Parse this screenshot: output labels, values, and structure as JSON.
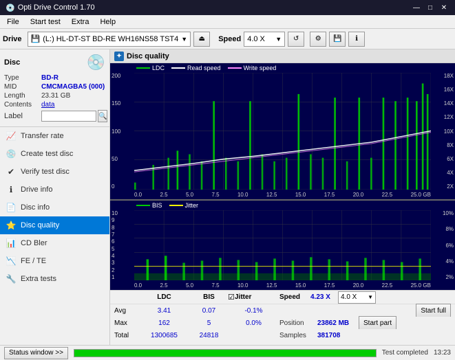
{
  "titlebar": {
    "title": "Opti Drive Control 1.70",
    "icon": "💿",
    "controls": [
      "—",
      "□",
      "✕"
    ]
  },
  "menubar": {
    "items": [
      "File",
      "Start test",
      "Extra",
      "Help"
    ]
  },
  "toolbar": {
    "drive_label": "Drive",
    "drive_icon": "💾",
    "drive_text": "(L:)  HL-DT-ST BD-RE  WH16NS58 TST4",
    "speed_label": "Speed",
    "speed_value": "4.0 X"
  },
  "disc": {
    "title": "Disc",
    "type_label": "Type",
    "type_value": "BD-R",
    "mid_label": "MID",
    "mid_value": "CMCMAGBA5 (000)",
    "length_label": "Length",
    "length_value": "23.31 GB",
    "contents_label": "Contents",
    "contents_value": "data",
    "label_label": "Label",
    "label_value": ""
  },
  "nav": {
    "items": [
      {
        "id": "transfer-rate",
        "label": "Transfer rate",
        "icon": "📈"
      },
      {
        "id": "create-test-disc",
        "label": "Create test disc",
        "icon": "💿"
      },
      {
        "id": "verify-test-disc",
        "label": "Verify test disc",
        "icon": "✔"
      },
      {
        "id": "drive-info",
        "label": "Drive info",
        "icon": "ℹ"
      },
      {
        "id": "disc-info",
        "label": "Disc info",
        "icon": "📄"
      },
      {
        "id": "disc-quality",
        "label": "Disc quality",
        "icon": "⭐",
        "active": true
      },
      {
        "id": "cd-bler",
        "label": "CD Bler",
        "icon": "📊"
      },
      {
        "id": "fe-te",
        "label": "FE / TE",
        "icon": "📉"
      },
      {
        "id": "extra-tests",
        "label": "Extra tests",
        "icon": "🔧"
      }
    ]
  },
  "chart": {
    "title": "Disc quality",
    "top": {
      "legend": [
        {
          "label": "LDC",
          "color": "#00aa00"
        },
        {
          "label": "Read speed",
          "color": "#ffffff"
        },
        {
          "label": "Write speed",
          "color": "#ff00ff"
        }
      ],
      "y_left": [
        "200",
        "150",
        "100",
        "50",
        "0"
      ],
      "y_right": [
        "18X",
        "16X",
        "14X",
        "12X",
        "10X",
        "8X",
        "6X",
        "4X",
        "2X"
      ],
      "x_labels": [
        "0.0",
        "2.5",
        "5.0",
        "7.5",
        "10.0",
        "12.5",
        "15.0",
        "17.5",
        "20.0",
        "22.5",
        "25.0 GB"
      ]
    },
    "bottom": {
      "legend": [
        {
          "label": "BIS",
          "color": "#00aa00"
        },
        {
          "label": "Jitter",
          "color": "#ffff00"
        }
      ],
      "y_left": [
        "10",
        "9",
        "8",
        "7",
        "6",
        "5",
        "4",
        "3",
        "2",
        "1"
      ],
      "y_right": [
        "10%",
        "8%",
        "6%",
        "4%",
        "2%"
      ],
      "x_labels": [
        "0.0",
        "2.5",
        "5.0",
        "7.5",
        "10.0",
        "12.5",
        "15.0",
        "17.5",
        "20.0",
        "22.5",
        "25.0 GB"
      ]
    }
  },
  "stats": {
    "headers": [
      "LDC",
      "BIS",
      "Jitter",
      "Speed"
    ],
    "jitter_checked": true,
    "speed_current": "4.23 X",
    "speed_combo": "4.0 X",
    "rows": [
      {
        "label": "Avg",
        "ldc": "3.41",
        "bis": "0.07",
        "jitter": "-0.1%"
      },
      {
        "label": "Max",
        "ldc": "162",
        "bis": "5",
        "jitter": "0.0%",
        "position_label": "Position",
        "position_val": "23862 MB"
      },
      {
        "label": "Total",
        "ldc": "1300685",
        "bis": "24818",
        "jitter": "",
        "samples_label": "Samples",
        "samples_val": "381708"
      }
    ],
    "btn_start_full": "Start full",
    "btn_start_part": "Start part"
  },
  "statusbar": {
    "btn_label": "Status window >>",
    "progress": 100,
    "status_text": "Test completed",
    "time": "13:23"
  }
}
